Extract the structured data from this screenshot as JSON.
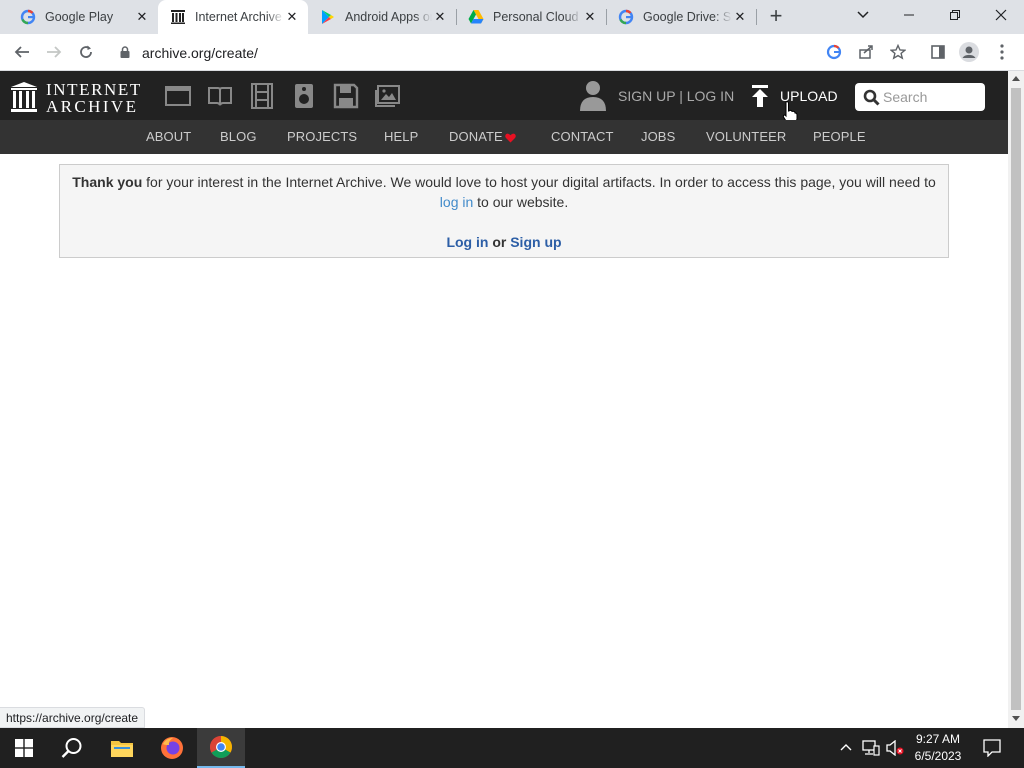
{
  "browser": {
    "tabs": [
      {
        "title": "Google Play",
        "active": false,
        "favicon": "google-g-icon"
      },
      {
        "title": "Internet Archive",
        "active": true,
        "favicon": "internet-archive-icon"
      },
      {
        "title": "Android Apps on Google Play",
        "active": false,
        "favicon": "google-play-icon"
      },
      {
        "title": "Personal Cloud Storage",
        "active": false,
        "favicon": "google-drive-icon"
      },
      {
        "title": "Google Drive: Sign-in",
        "active": false,
        "favicon": "google-g-icon"
      }
    ],
    "url": "archive.org/create/",
    "status_url": "https://archive.org/create"
  },
  "ia": {
    "logo_line1": "INTERNET",
    "logo_line2": "ARCHIVE",
    "signup_login": "SIGN UP | LOG IN",
    "upload": "UPLOAD",
    "search_placeholder": "Search",
    "nav": [
      "ABOUT",
      "BLOG",
      "PROJECTS",
      "HELP",
      "DONATE",
      "CONTACT",
      "JOBS",
      "VOLUNTEER",
      "PEOPLE"
    ]
  },
  "notice": {
    "thank_you": "Thank you",
    "text1": " for your interest in the Internet Archive. We would love to host your digital artifacts. In order to access this page, you will need to",
    "login_link": "log in",
    "text2": " to our website.",
    "login_button": "Log in",
    "or": " or ",
    "signup_button": "Sign up"
  },
  "taskbar": {
    "time": "9:27 AM",
    "date": "6/5/2023"
  },
  "colors": {
    "ia_header": "#222222",
    "ia_nav": "#333333",
    "link": "#428bca",
    "donate_heart": "#e81123"
  }
}
